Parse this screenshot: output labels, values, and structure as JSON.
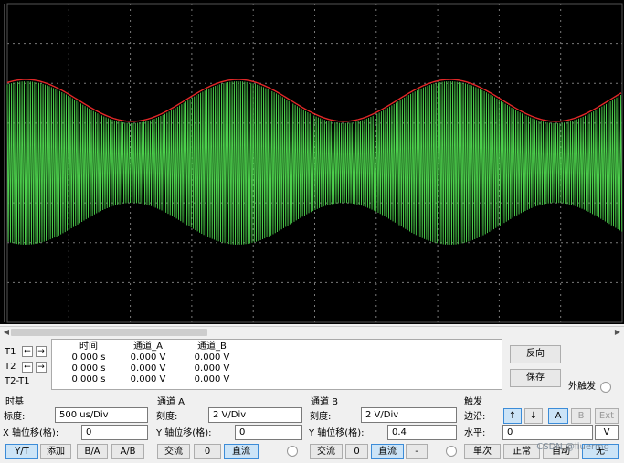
{
  "cursors": {
    "rows": [
      {
        "label": "T1"
      },
      {
        "label": "T2"
      },
      {
        "label": "T2-T1"
      }
    ],
    "columns": [
      {
        "header": "时间",
        "values": [
          "0.000 s",
          "0.000 s",
          "0.000 s"
        ]
      },
      {
        "header": "通道_A",
        "values": [
          "0.000 V",
          "0.000 V",
          "0.000 V"
        ]
      },
      {
        "header": "通道_B",
        "values": [
          "0.000 V",
          "0.000 V",
          "0.000 V"
        ]
      }
    ],
    "reverse_label": "反向",
    "save_label": "保存",
    "ext_trigger_label": "外触发"
  },
  "timebase": {
    "title": "时基",
    "scale_label": "标度:",
    "scale_value": "500 us/Div",
    "xpos_label": "X 轴位移(格):",
    "xpos_value": "0",
    "buttons": [
      "Y/T",
      "添加",
      "B/A",
      "A/B"
    ]
  },
  "channel_a": {
    "title": "通道 A",
    "scale_label": "刻度:",
    "scale_value": "2  V/Div",
    "ypos_label": "Y 轴位移(格):",
    "ypos_value": "0",
    "buttons": [
      "交流",
      "0",
      "直流"
    ]
  },
  "channel_b": {
    "title": "通道 B",
    "scale_label": "刻度:",
    "scale_value": "2  V/Div",
    "ypos_label": "Y 轴位移(格):",
    "ypos_value": "0.4",
    "buttons": [
      "交流",
      "0",
      "直流",
      "-"
    ]
  },
  "trigger": {
    "title": "触发",
    "edge_label": "边沿:",
    "edge_buttons": [
      "↑",
      "↓",
      "A",
      "B",
      "Ext"
    ],
    "level_label": "水平:",
    "level_value": "0",
    "level_unit": "V",
    "mode_buttons": [
      "单次",
      "正常",
      "自动",
      "无"
    ]
  },
  "watermark": "CSDN @liuermg",
  "colors": {
    "screen": "#000000",
    "grid": "#7a7a7a",
    "channel_a_trace": "#4cd04c",
    "channel_b_trace": "#e02828",
    "baseline": "#ffffff"
  }
}
